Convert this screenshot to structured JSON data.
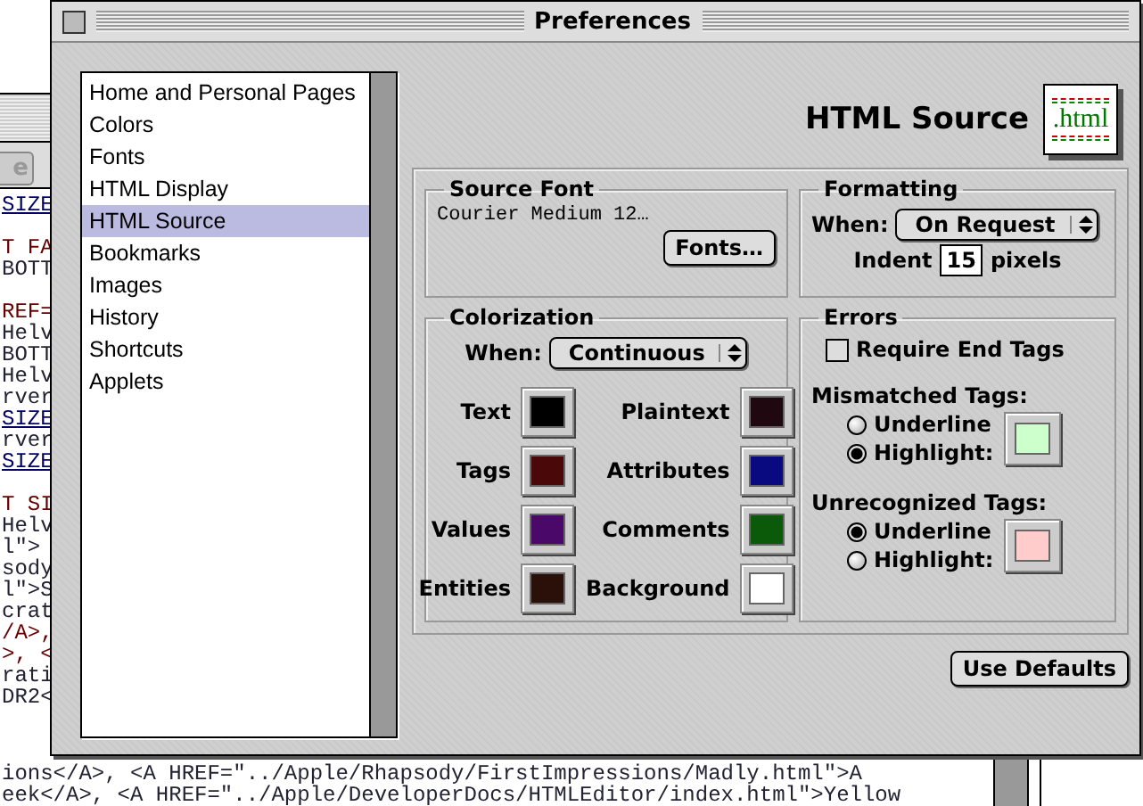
{
  "background_window": {
    "button": "e",
    "code_lines": [
      {
        "text": "SIZE",
        "kind": "link"
      },
      {
        "kind": "plain"
      },
      {
        "text": "T FA",
        "kind": "tag"
      },
      {
        "text": "BOTT",
        "kind": "plain"
      },
      {
        "kind": "plain"
      },
      {
        "text": "REF=",
        "kind": "tag"
      },
      {
        "text": "Helv",
        "kind": "plain"
      },
      {
        "text": "BOTT",
        "kind": "plain"
      },
      {
        "text": "Helv",
        "kind": "plain"
      },
      {
        "text": "rver",
        "kind": "plain"
      },
      {
        "text": "SIZE",
        "kind": "link"
      },
      {
        "text": "rver",
        "kind": "plain"
      },
      {
        "text": "SIZE",
        "kind": "link"
      },
      {
        "kind": "plain"
      },
      {
        "text": "T SI",
        "kind": "tag"
      },
      {
        "text": "Helv",
        "kind": "plain"
      },
      {
        "text": "l\">",
        "kind": "plain"
      },
      {
        "text": "sody",
        "kind": "plain"
      },
      {
        "text": "l\">S",
        "kind": "plain"
      },
      {
        "text": "crat",
        "kind": "plain"
      },
      {
        "text": "/A>,",
        "kind": "tag"
      },
      {
        "text": ">, <",
        "kind": "tag"
      },
      {
        "text": "rati",
        "kind": "plain"
      },
      {
        "text": "DR2<",
        "kind": "plain"
      }
    ],
    "bottom_lines": [
      "ions</A>, <A HREF=\"../Apple/Rhapsody/FirstImpressions/Madly.html\">A",
      "eek</A>, <A HREF=\"../Apple/DeveloperDocs/HTMLEditor/index.html\">Yellow"
    ]
  },
  "window": {
    "title": "Preferences"
  },
  "sidebar": {
    "items": [
      {
        "label": "Home and Personal Pages",
        "selected": false
      },
      {
        "label": "Colors",
        "selected": false
      },
      {
        "label": "Fonts",
        "selected": false
      },
      {
        "label": "HTML Display",
        "selected": false
      },
      {
        "label": "HTML Source",
        "selected": true
      },
      {
        "label": "Bookmarks",
        "selected": false
      },
      {
        "label": "Images",
        "selected": false
      },
      {
        "label": "History",
        "selected": false
      },
      {
        "label": "Shortcuts",
        "selected": false
      },
      {
        "label": "Applets",
        "selected": false
      }
    ]
  },
  "panel_title": "HTML Source",
  "file_icon": {
    "label": ".html"
  },
  "source_font": {
    "label": "Source Font",
    "value": "Courier Medium 12…",
    "button": "Fonts…"
  },
  "formatting": {
    "label": "Formatting",
    "when_label": "When:",
    "when_value": "On Request",
    "indent_label": "Indent",
    "indent_value": "15",
    "unit": "pixels"
  },
  "colorization": {
    "label": "Colorization",
    "when_label": "When:",
    "when_value": "Continuous",
    "colors": [
      {
        "name": "Text",
        "color": "#000000"
      },
      {
        "name": "Plaintext",
        "color": "#200810"
      },
      {
        "name": "Tags",
        "color": "#4a0808"
      },
      {
        "name": "Attributes",
        "color": "#0a0a80"
      },
      {
        "name": "Values",
        "color": "#4a0868"
      },
      {
        "name": "Comments",
        "color": "#0a5a0a"
      },
      {
        "name": "Entities",
        "color": "#2a1008"
      },
      {
        "name": "Background",
        "color": "#ffffff"
      }
    ]
  },
  "errors": {
    "label": "Errors",
    "require_end_tags": {
      "label": "Require End Tags",
      "checked": false
    },
    "groups": [
      {
        "label": "Mismatched Tags:",
        "options": [
          {
            "label": "Underline",
            "selected": false
          },
          {
            "label": "Highlight:",
            "selected": true
          }
        ],
        "color": "#ccffcc"
      },
      {
        "label": "Unrecognized Tags:",
        "options": [
          {
            "label": "Underline",
            "selected": true
          },
          {
            "label": "Highlight:",
            "selected": false
          }
        ],
        "color": "#ffcccc"
      }
    ]
  },
  "buttons": [
    "Use Defaults"
  ]
}
